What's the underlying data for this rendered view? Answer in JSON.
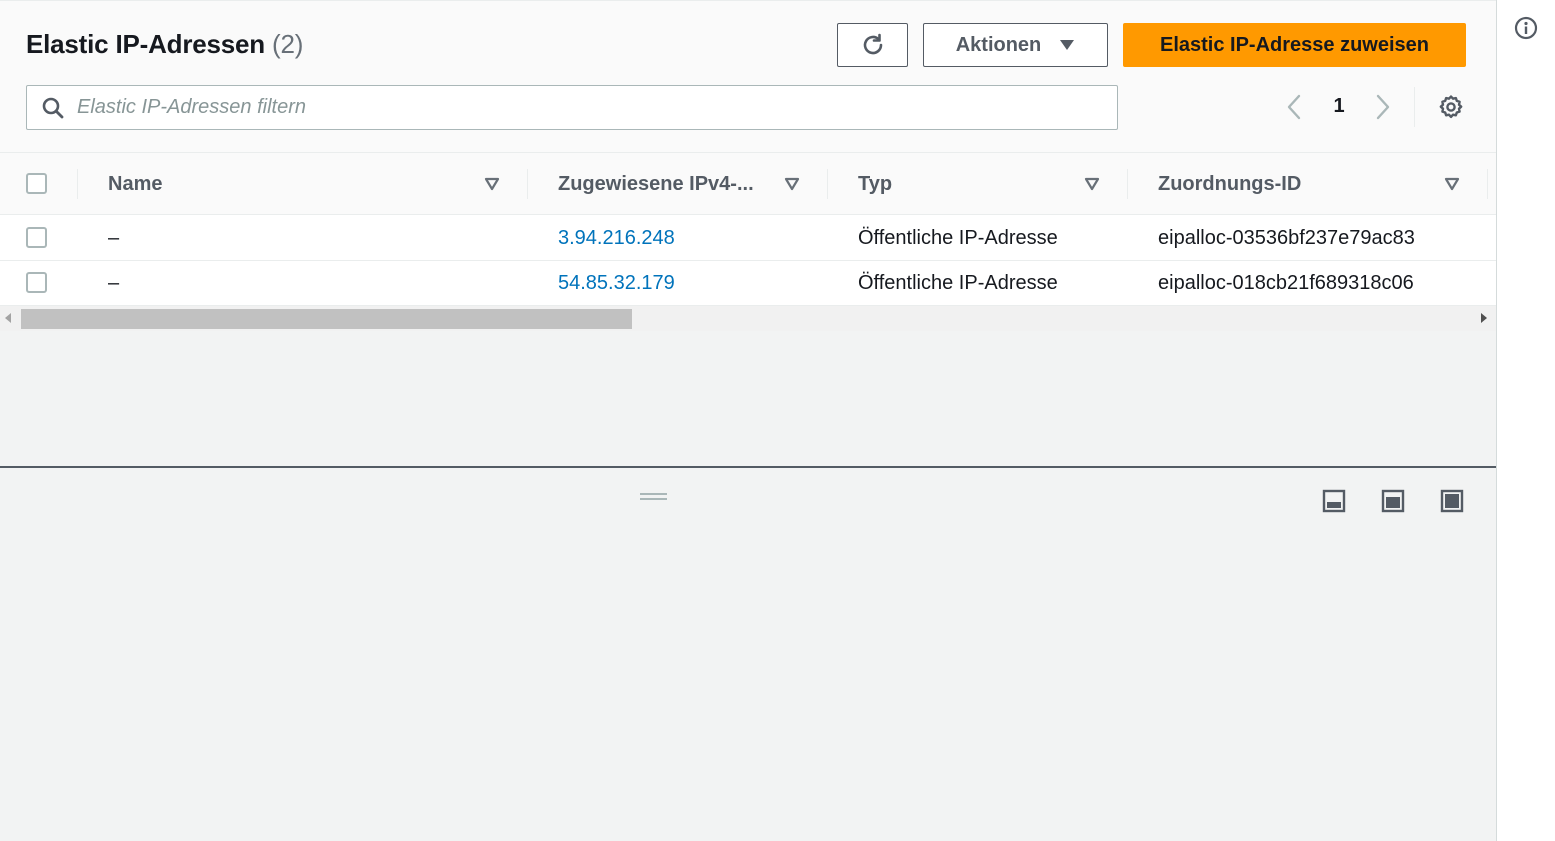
{
  "header": {
    "title": "Elastic IP-Adressen",
    "count": "(2)"
  },
  "toolbar": {
    "refresh_icon": "refresh-icon",
    "actions_label": "Aktionen",
    "primary_label": "Elastic IP-Adresse zuweisen"
  },
  "filter": {
    "placeholder": "Elastic IP-Adressen filtern",
    "value": ""
  },
  "pagination": {
    "current_page": "1"
  },
  "columns": [
    {
      "label": "Name"
    },
    {
      "label": "Zugewiesene IPv4-..."
    },
    {
      "label": "Typ"
    },
    {
      "label": "Zuordnungs-ID"
    }
  ],
  "rows": [
    {
      "name": "–",
      "ip": "3.94.216.248",
      "type": "Öffentliche IP-Adresse",
      "id": "eipalloc-03536bf237e79ac83"
    },
    {
      "name": "–",
      "ip": "54.85.32.179",
      "type": "Öffentliche IP-Adresse",
      "id": "eipalloc-018cb21f689318c06"
    }
  ],
  "colors": {
    "primary": "#ff9900",
    "link": "#0073bb",
    "text": "#16191f",
    "muted": "#545b64"
  }
}
